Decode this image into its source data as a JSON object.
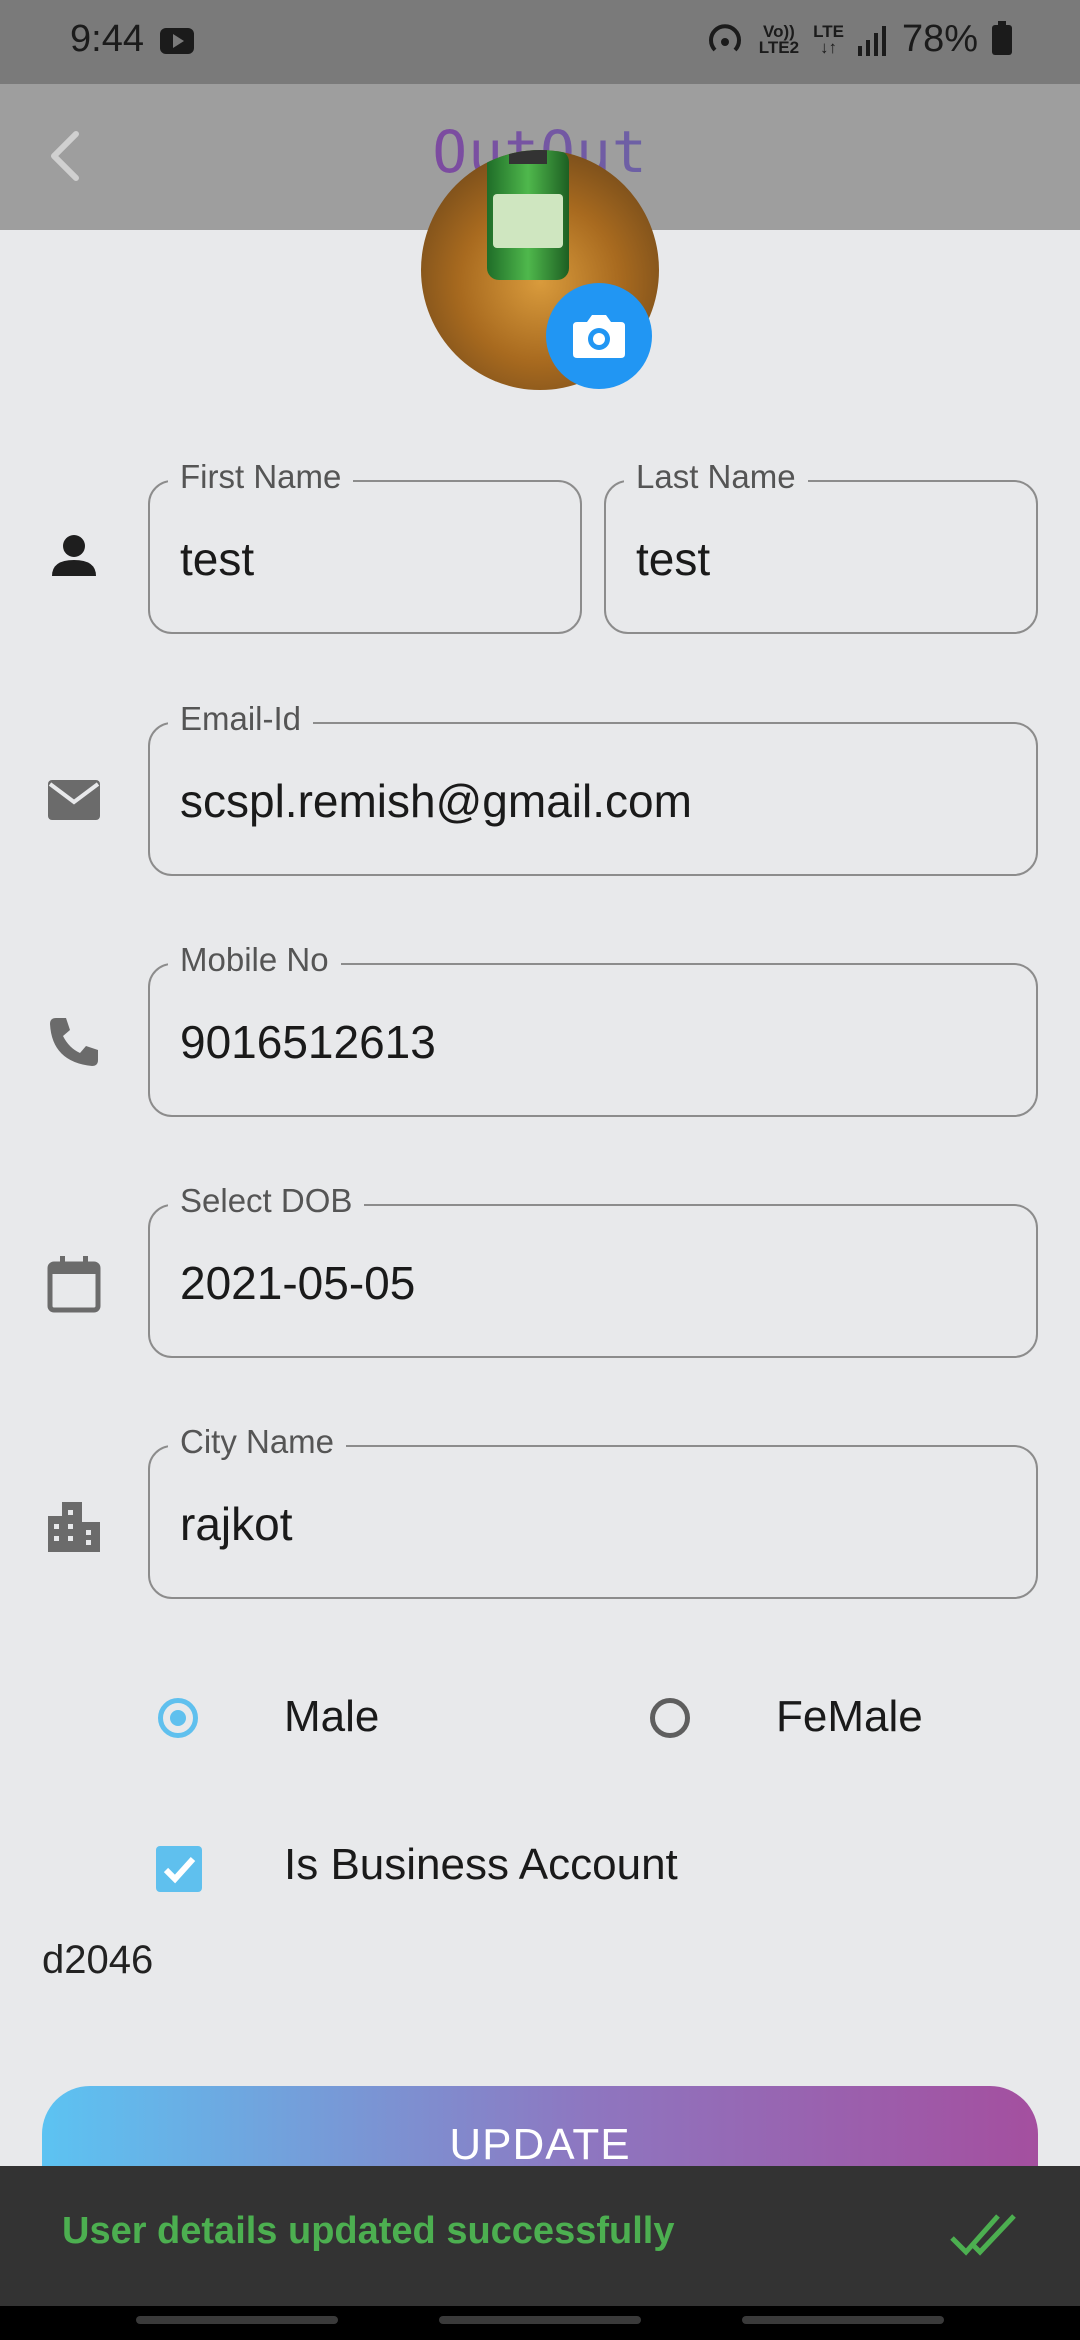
{
  "status_bar": {
    "time": "9:44",
    "volte_top": "Vo))",
    "volte_bottom": "LTE2",
    "lte": "LTE",
    "battery": "78%"
  },
  "app_bar": {
    "title": "OutOut"
  },
  "form": {
    "first_name": {
      "label": "First Name",
      "value": "test"
    },
    "last_name": {
      "label": "Last Name",
      "value": "test"
    },
    "email": {
      "label": "Email-Id",
      "value": "scspl.remish@gmail.com"
    },
    "mobile": {
      "label": "Mobile No",
      "value": "9016512613"
    },
    "dob": {
      "label": "Select DOB",
      "value": "2021-05-05"
    },
    "city": {
      "label": "City Name",
      "value": "rajkot"
    },
    "gender": {
      "male": "Male",
      "female": "FeMale",
      "selected": "Male"
    },
    "business": {
      "label": "Is Business Account",
      "checked": true
    }
  },
  "code": "d2046",
  "update_button": "UPDATE",
  "snackbar": {
    "message": "User details updated successfully"
  },
  "colors": {
    "accent": "#2196f3",
    "radio": "#5fc0ee",
    "success": "#4caf50",
    "gradient_start": "#5cc3f2",
    "gradient_end": "#a44f9f"
  }
}
